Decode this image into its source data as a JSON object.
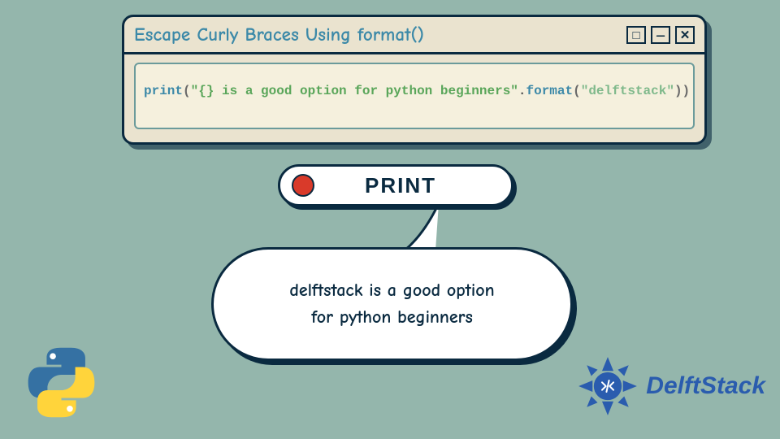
{
  "window": {
    "title": "Escape Curly Braces Using format()",
    "controls": {
      "maximize": "□",
      "minimize": "—",
      "close": "✕"
    }
  },
  "code": {
    "fn": "print",
    "open": "(",
    "string": "\"{} is a good option for python beginners\"",
    "dot": ".",
    "method": "format",
    "open2": "(",
    "arg": "\"delftstack\"",
    "close2": ")",
    "close": ")"
  },
  "print_pill": {
    "label": "PRINT"
  },
  "output": {
    "line1": "delftstack is a good option",
    "line2": "for python beginners"
  },
  "brand": {
    "name": "DelftStack"
  },
  "colors": {
    "bg": "#94b6ac",
    "panel": "#eae3cf",
    "border": "#0a2a40",
    "accent_blue": "#3c89a8",
    "string_green": "#5aa65a",
    "red": "#d93a2a",
    "brand_blue": "#2a5cae"
  }
}
